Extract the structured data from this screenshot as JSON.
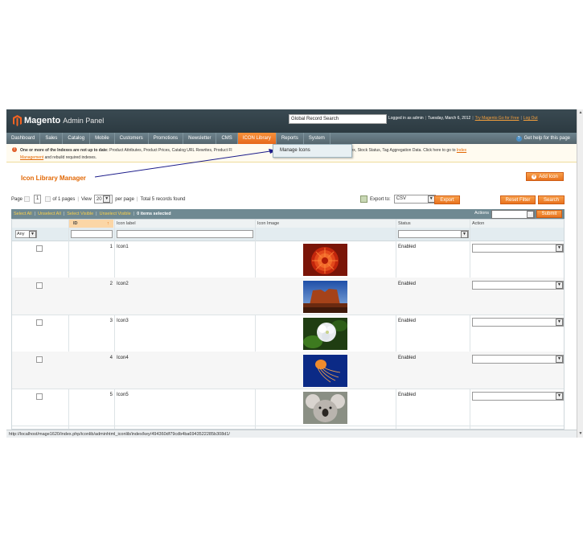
{
  "header": {
    "brand": "Magento",
    "title": "Admin Panel",
    "search_placeholder": "Global Record Search",
    "logged_in": "Logged in as admin",
    "date": "Tuesday, March 6, 2012",
    "try_link": "Try Magento Go for Free",
    "logout": "Log Out"
  },
  "nav": {
    "items": [
      "Dashboard",
      "Sales",
      "Catalog",
      "Mobile",
      "Customers",
      "Promotions",
      "Newsletter",
      "CMS",
      "ICON Library",
      "Reports",
      "System"
    ],
    "active": "ICON Library",
    "help": "Get help for this page",
    "dropdown_item": "Manage Icons"
  },
  "notice": {
    "bold": "One or more of the Indexes are not up to date:",
    "text_a": "Product Attributes, Product Prices, Catalog URL Rewrites, Product Fl",
    "text_b": "roducts, Catalog Search Index, Stock Status, Tag Aggregation Data. Click here to go to",
    "link_a": "Index",
    "link_b": "Management",
    "tail": "and rebuild required indexes."
  },
  "page": {
    "title": "Icon Library Manager",
    "add_button": "Add Icon"
  },
  "pager": {
    "page_label": "Page",
    "page_value": "1",
    "of_pages": "of 1 pages",
    "view_label": "View",
    "per_page_value": "20",
    "per_page_label": "per page",
    "total": "Total 5 records found",
    "export_label": "Export to:",
    "export_value": "CSV",
    "export_button": "Export",
    "reset_button": "Reset Filter",
    "search_button": "Search"
  },
  "massaction": {
    "select_all": "Select All",
    "unselect_all": "Unselect All",
    "select_visible": "Select Visible",
    "unselect_visible": "Unselect Visible",
    "selected": "0 items selected",
    "actions_label": "Actions",
    "submit": "Submit"
  },
  "columns": {
    "id": "ID",
    "label": "Icon label",
    "image": "Icon Image",
    "status": "Status",
    "action": "Action",
    "filter_any": "Any"
  },
  "rows": [
    {
      "id": "1",
      "label": "Icon1",
      "status": "Enabled",
      "image": "red-flower"
    },
    {
      "id": "2",
      "label": "Icon2",
      "status": "Enabled",
      "image": "desert-rock"
    },
    {
      "id": "3",
      "label": "Icon3",
      "status": "Enabled",
      "image": "white-hydrangea"
    },
    {
      "id": "4",
      "label": "Icon4",
      "status": "Enabled",
      "image": "jellyfish"
    },
    {
      "id": "5",
      "label": "Icon5",
      "status": "Enabled",
      "image": "koala"
    }
  ],
  "statusbar": {
    "url": "http://localhost/mage1620/index.php/iconlib/adminhtml_iconlib/index/key/494360df79cdb4ba6943522285b308d1/"
  },
  "colors": {
    "accent": "#e26703",
    "header": "#2c3a41",
    "nav": "#56666e",
    "massaction": "#6f8992"
  }
}
